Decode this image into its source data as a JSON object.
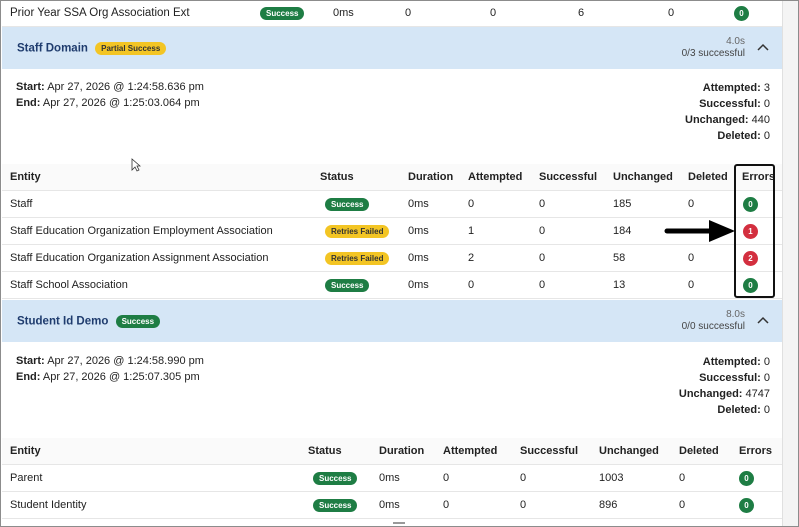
{
  "top_row": {
    "entity": "Prior Year SSA Org Association Ext",
    "status": "Success",
    "duration": "0ms",
    "attempted": "0",
    "successful": "0",
    "unchanged": "6",
    "deleted": "0",
    "errors": "0"
  },
  "groups": [
    {
      "name": "Staff Domain",
      "status": "Partial Success",
      "duration": "4.0s",
      "summary": "0/3 successful",
      "start_label": "Start:",
      "start": "Apr 27, 2026 @ 1:24:58.636 pm",
      "end_label": "End:",
      "end": "Apr 27, 2026 @ 1:25:03.064 pm",
      "stats": {
        "attempted_label": "Attempted:",
        "attempted": "3",
        "successful_label": "Successful:",
        "successful": "0",
        "unchanged_label": "Unchanged:",
        "unchanged": "440",
        "deleted_label": "Deleted:",
        "deleted": "0"
      },
      "columns": [
        "Entity",
        "Status",
        "Duration",
        "Attempted",
        "Successful",
        "Unchanged",
        "Deleted",
        "Errors"
      ],
      "rows": [
        {
          "entity": "Staff",
          "status": "Success",
          "duration": "0ms",
          "attempted": "0",
          "successful": "0",
          "unchanged": "185",
          "deleted": "0",
          "errors": "0"
        },
        {
          "entity": "Staff Education Organization Employment Association",
          "status": "Retries Failed",
          "duration": "0ms",
          "attempted": "1",
          "successful": "0",
          "unchanged": "184",
          "deleted": "",
          "errors": "1"
        },
        {
          "entity": "Staff Education Organization Assignment Association",
          "status": "Retries Failed",
          "duration": "0ms",
          "attempted": "2",
          "successful": "0",
          "unchanged": "58",
          "deleted": "0",
          "errors": "2"
        },
        {
          "entity": "Staff School Association",
          "status": "Success",
          "duration": "0ms",
          "attempted": "0",
          "successful": "0",
          "unchanged": "13",
          "deleted": "0",
          "errors": "0"
        }
      ]
    },
    {
      "name": "Student Id Demo",
      "status": "Success",
      "duration": "8.0s",
      "summary": "0/0 successful",
      "start_label": "Start:",
      "start": "Apr 27, 2026 @ 1:24:58.990 pm",
      "end_label": "End:",
      "end": "Apr 27, 2026 @ 1:25:07.305 pm",
      "stats": {
        "attempted_label": "Attempted:",
        "attempted": "0",
        "successful_label": "Successful:",
        "successful": "0",
        "unchanged_label": "Unchanged:",
        "unchanged": "4747",
        "deleted_label": "Deleted:",
        "deleted": "0"
      },
      "columns": [
        "Entity",
        "Status",
        "Duration",
        "Attempted",
        "Successful",
        "Unchanged",
        "Deleted",
        "Errors"
      ],
      "rows": [
        {
          "entity": "Parent",
          "status": "Success",
          "duration": "0ms",
          "attempted": "0",
          "successful": "0",
          "unchanged": "1003",
          "deleted": "0",
          "errors": "0"
        },
        {
          "entity": "Student Identity",
          "status": "Success",
          "duration": "0ms",
          "attempted": "0",
          "successful": "0",
          "unchanged": "896",
          "deleted": "0",
          "errors": "0"
        }
      ]
    }
  ],
  "colors": {
    "success": "#1e7d44",
    "warning": "#f3c524",
    "error": "#d32f3f",
    "banner": "#d5e6f6",
    "title": "#1f3c6e"
  },
  "icons": {
    "collapse": "chevron-up-icon",
    "pointer": "arrow-right-icon",
    "cursor": "mouse-cursor-icon"
  }
}
